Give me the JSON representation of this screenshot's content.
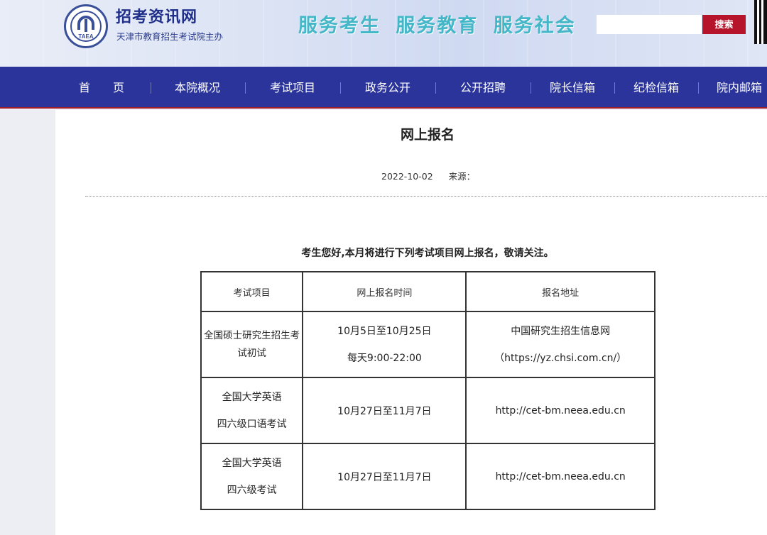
{
  "header": {
    "site_title": "招考资讯网",
    "site_subtitle": "天津市教育招生考试院主办",
    "logo_text": "TAEA",
    "slogan": "服务考生 服务教育 服务社会",
    "search_placeholder": "",
    "search_button": "搜索"
  },
  "nav": {
    "items": [
      "首　　页",
      "本院概况",
      "考试项目",
      "政务公开",
      "公开招聘",
      "院长信箱",
      "纪检信箱",
      "院内邮箱"
    ]
  },
  "article": {
    "title": "网上报名",
    "date": "2022-10-02",
    "source_label": "来源：",
    "intro": "考生您好,本月将进行下列考试项目网上报名，敬请关注。",
    "table": {
      "headers": [
        "考试项目",
        "网上报名时间",
        "报名地址"
      ],
      "rows": [
        {
          "exam": [
            "全国硕士研究生招生考",
            "试初试"
          ],
          "time": [
            "10月5日至10月25日",
            "每天9:00-22:00"
          ],
          "address": [
            "中国研究生招生信息网",
            "（https://yz.chsi.com.cn/）"
          ]
        },
        {
          "exam": [
            "全国大学英语",
            "四六级口语考试"
          ],
          "time": [
            "10月27日至11月7日"
          ],
          "address": [
            "http://cet-bm.neea.edu.cn"
          ]
        },
        {
          "exam": [
            "全国大学英语",
            "四六级考试"
          ],
          "time": [
            "10月27日至11月7日"
          ],
          "address": [
            "http://cet-bm.neea.edu.cn"
          ]
        }
      ]
    }
  },
  "colors": {
    "nav_bg": "#2a349b",
    "search_button_bg": "#b5142b",
    "slogan": "#43b7c7",
    "title": "#1f2f8a"
  }
}
